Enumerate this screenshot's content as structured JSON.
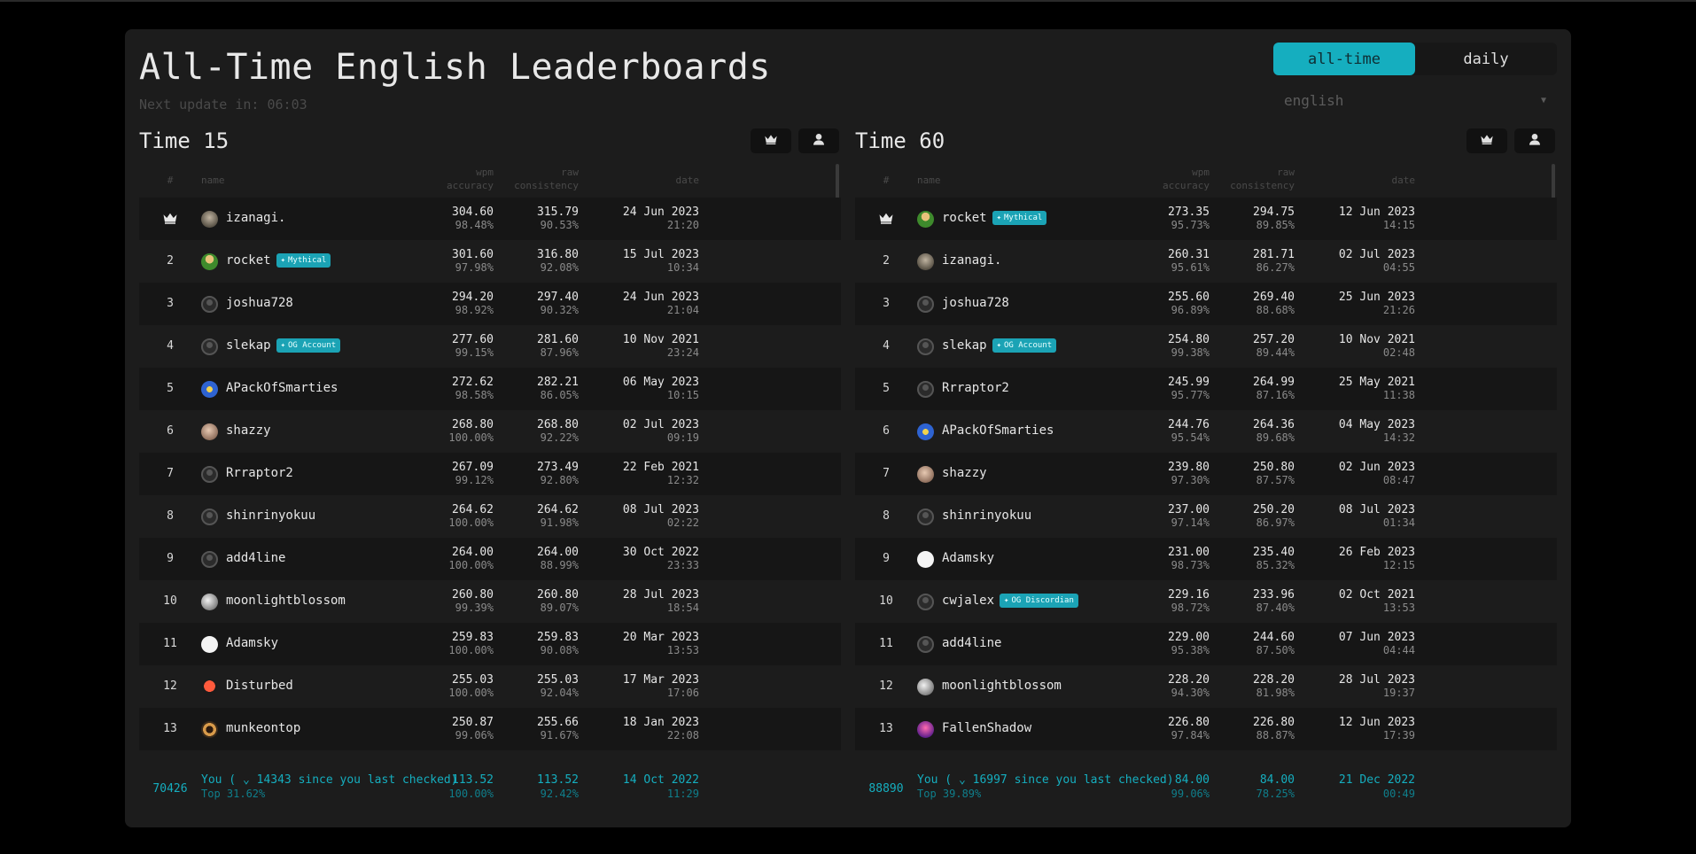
{
  "page": {
    "title": "All-Time English Leaderboards",
    "next_update": "Next update in: 06:03"
  },
  "mode_toggle": {
    "all_time": "all-time",
    "daily": "daily",
    "selected": "all-time"
  },
  "language": {
    "value": "english"
  },
  "accent_color": "#15aebf",
  "columns": {
    "rank": "#",
    "name": "name",
    "wpm": "wpm",
    "accuracy": "accuracy",
    "raw": "raw",
    "consistency": "consistency",
    "date": "date"
  },
  "boards": [
    {
      "title": "Time 15",
      "buttons": {
        "crown_icon": "crown-icon",
        "user_icon": "user-icon"
      },
      "rows": [
        {
          "rank": "",
          "crown": true,
          "name": "izanagi.",
          "avatar": "photo-gray",
          "badge": "",
          "wpm": "304.60",
          "acc": "98.48%",
          "raw": "315.79",
          "cons": "90.53%",
          "date": "24 Jun 2023",
          "time": "21:20"
        },
        {
          "rank": "2",
          "name": "rocket",
          "avatar": "photo-green",
          "badge": "Mythical",
          "wpm": "301.60",
          "acc": "97.98%",
          "raw": "316.80",
          "cons": "92.08%",
          "date": "15 Jul 2023",
          "time": "10:34"
        },
        {
          "rank": "3",
          "name": "joshua728",
          "avatar": "default",
          "badge": "",
          "wpm": "294.20",
          "acc": "98.92%",
          "raw": "297.40",
          "cons": "90.32%",
          "date": "24 Jun 2023",
          "time": "21:04"
        },
        {
          "rank": "4",
          "name": "slekap",
          "avatar": "default",
          "badge": "OG Account",
          "wpm": "277.60",
          "acc": "99.15%",
          "raw": "281.60",
          "cons": "87.96%",
          "date": "10 Nov 2021",
          "time": "23:24"
        },
        {
          "rank": "5",
          "name": "APackOfSmarties",
          "avatar": "photo-blue",
          "badge": "",
          "wpm": "272.62",
          "acc": "98.58%",
          "raw": "282.21",
          "cons": "86.05%",
          "date": "06 May 2023",
          "time": "10:15"
        },
        {
          "rank": "6",
          "name": "shazzy",
          "avatar": "photo-tan",
          "badge": "",
          "wpm": "268.80",
          "acc": "100.00%",
          "raw": "268.80",
          "cons": "92.22%",
          "date": "02 Jul 2023",
          "time": "09:19"
        },
        {
          "rank": "7",
          "name": "Rrraptor2",
          "avatar": "default",
          "badge": "",
          "wpm": "267.09",
          "acc": "99.12%",
          "raw": "273.49",
          "cons": "92.80%",
          "date": "22 Feb 2021",
          "time": "12:32"
        },
        {
          "rank": "8",
          "name": "shinrinyokuu",
          "avatar": "default",
          "badge": "",
          "wpm": "264.62",
          "acc": "100.00%",
          "raw": "264.62",
          "cons": "91.98%",
          "date": "08 Jul 2023",
          "time": "02:22"
        },
        {
          "rank": "9",
          "name": "add4line",
          "avatar": "default",
          "badge": "",
          "wpm": "264.00",
          "acc": "100.00%",
          "raw": "264.00",
          "cons": "88.99%",
          "date": "30 Oct 2022",
          "time": "23:33"
        },
        {
          "rank": "10",
          "name": "moonlightblossom",
          "avatar": "photo-light",
          "badge": "",
          "wpm": "260.80",
          "acc": "99.39%",
          "raw": "260.80",
          "cons": "89.07%",
          "date": "28 Jul 2023",
          "time": "18:54"
        },
        {
          "rank": "11",
          "name": "Adamsky",
          "avatar": "white",
          "badge": "",
          "wpm": "259.83",
          "acc": "100.00%",
          "raw": "259.83",
          "cons": "90.08%",
          "date": "20 Mar 2023",
          "time": "13:53"
        },
        {
          "rank": "12",
          "name": "Disturbed",
          "avatar": "photo-red",
          "badge": "",
          "wpm": "255.03",
          "acc": "100.00%",
          "raw": "255.03",
          "cons": "92.04%",
          "date": "17 Mar 2023",
          "time": "17:06"
        },
        {
          "rank": "13",
          "name": "munkeontop",
          "avatar": "photo-brown",
          "badge": "",
          "wpm": "250.87",
          "acc": "99.06%",
          "raw": "255.66",
          "cons": "91.67%",
          "date": "18 Jan 2023",
          "time": "22:08"
        }
      ],
      "you": {
        "rank": "70426",
        "text": "You ( ⌄ 14343 since you last checked)",
        "sub": "Top 31.62%",
        "wpm": "113.52",
        "acc": "100.00%",
        "raw": "113.52",
        "cons": "92.42%",
        "date": "14 Oct 2022",
        "time": "11:29"
      }
    },
    {
      "title": "Time 60",
      "buttons": {
        "crown_icon": "crown-icon",
        "user_icon": "user-icon"
      },
      "rows": [
        {
          "rank": "",
          "crown": true,
          "name": "rocket",
          "avatar": "photo-green",
          "badge": "Mythical",
          "wpm": "273.35",
          "acc": "95.73%",
          "raw": "294.75",
          "cons": "89.85%",
          "date": "12 Jun 2023",
          "time": "14:15"
        },
        {
          "rank": "2",
          "name": "izanagi.",
          "avatar": "photo-gray",
          "badge": "",
          "wpm": "260.31",
          "acc": "95.61%",
          "raw": "281.71",
          "cons": "86.27%",
          "date": "02 Jul 2023",
          "time": "04:55"
        },
        {
          "rank": "3",
          "name": "joshua728",
          "avatar": "default",
          "badge": "",
          "wpm": "255.60",
          "acc": "96.89%",
          "raw": "269.40",
          "cons": "88.68%",
          "date": "25 Jun 2023",
          "time": "21:26"
        },
        {
          "rank": "4",
          "name": "slekap",
          "avatar": "default",
          "badge": "OG Account",
          "wpm": "254.80",
          "acc": "99.38%",
          "raw": "257.20",
          "cons": "89.44%",
          "date": "10 Nov 2021",
          "time": "02:48"
        },
        {
          "rank": "5",
          "name": "Rrraptor2",
          "avatar": "default",
          "badge": "",
          "wpm": "245.99",
          "acc": "95.77%",
          "raw": "264.99",
          "cons": "87.16%",
          "date": "25 May 2021",
          "time": "11:38"
        },
        {
          "rank": "6",
          "name": "APackOfSmarties",
          "avatar": "photo-blue",
          "badge": "",
          "wpm": "244.76",
          "acc": "95.54%",
          "raw": "264.36",
          "cons": "89.68%",
          "date": "04 May 2023",
          "time": "14:32"
        },
        {
          "rank": "7",
          "name": "shazzy",
          "avatar": "photo-tan",
          "badge": "",
          "wpm": "239.80",
          "acc": "97.30%",
          "raw": "250.80",
          "cons": "87.57%",
          "date": "02 Jun 2023",
          "time": "08:47"
        },
        {
          "rank": "8",
          "name": "shinrinyokuu",
          "avatar": "default",
          "badge": "",
          "wpm": "237.00",
          "acc": "97.14%",
          "raw": "250.20",
          "cons": "86.97%",
          "date": "08 Jul 2023",
          "time": "01:34"
        },
        {
          "rank": "9",
          "name": "Adamsky",
          "avatar": "white",
          "badge": "",
          "wpm": "231.00",
          "acc": "98.73%",
          "raw": "235.40",
          "cons": "85.32%",
          "date": "26 Feb 2023",
          "time": "12:15"
        },
        {
          "rank": "10",
          "name": "cwjalex",
          "avatar": "default",
          "badge": "OG Discordian",
          "wpm": "229.16",
          "acc": "98.72%",
          "raw": "233.96",
          "cons": "87.40%",
          "date": "02 Oct 2021",
          "time": "13:53"
        },
        {
          "rank": "11",
          "name": "add4line",
          "avatar": "default",
          "badge": "",
          "wpm": "229.00",
          "acc": "95.38%",
          "raw": "244.60",
          "cons": "87.50%",
          "date": "07 Jun 2023",
          "time": "04:44"
        },
        {
          "rank": "12",
          "name": "moonlightblossom",
          "avatar": "photo-light",
          "badge": "",
          "wpm": "228.20",
          "acc": "94.30%",
          "raw": "228.20",
          "cons": "81.98%",
          "date": "28 Jul 2023",
          "time": "19:37"
        },
        {
          "rank": "13",
          "name": "FallenShadow",
          "avatar": "photo-purple",
          "badge": "",
          "wpm": "226.80",
          "acc": "97.84%",
          "raw": "226.80",
          "cons": "88.87%",
          "date": "12 Jun 2023",
          "time": "17:39"
        }
      ],
      "you": {
        "rank": "88890",
        "text": "You ( ⌄ 16997 since you last checked)",
        "sub": "Top 39.89%",
        "wpm": "84.00",
        "acc": "99.06%",
        "raw": "84.00",
        "cons": "78.25%",
        "date": "21 Dec 2022",
        "time": "00:49"
      }
    }
  ]
}
